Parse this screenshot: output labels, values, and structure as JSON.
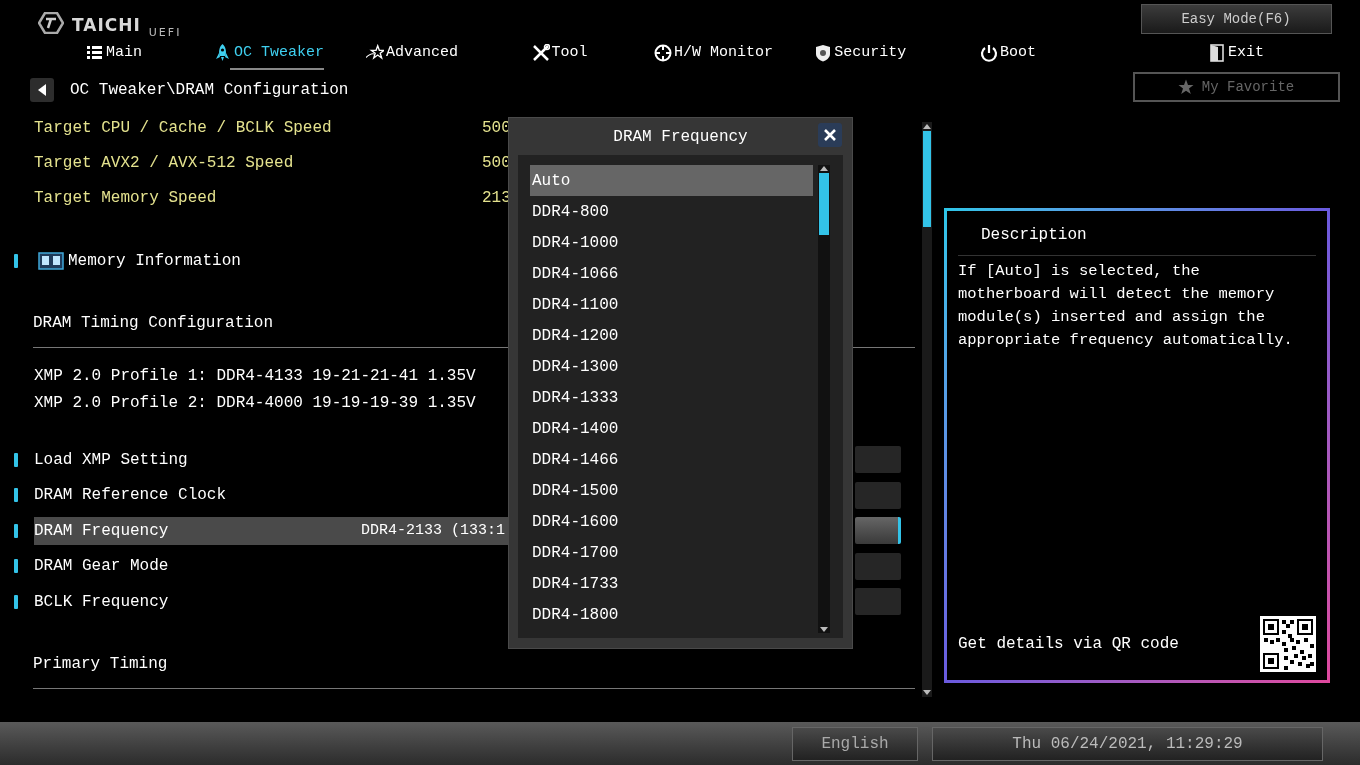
{
  "logo": {
    "brand": "TAICHI",
    "suffix": "UEFI"
  },
  "tabs": [
    {
      "label": "Main",
      "selected": false
    },
    {
      "label": "OC Tweaker",
      "selected": true
    },
    {
      "label": "Advanced",
      "selected": false
    },
    {
      "label": "Tool",
      "selected": false
    },
    {
      "label": "H/W Monitor",
      "selected": false
    },
    {
      "label": "Security",
      "selected": false
    },
    {
      "label": "Boot",
      "selected": false
    },
    {
      "label": "Exit",
      "selected": false
    }
  ],
  "easy_mode_button": "Easy Mode(F6)",
  "favorite_button": "My Favorite",
  "breadcrumb": "OC Tweaker\\DRAM Configuration",
  "settings": [
    {
      "kind": "info",
      "label": "Target CPU / Cache / BCLK Speed",
      "value": "500"
    },
    {
      "kind": "info",
      "label": "Target AVX2 / AVX-512 Speed",
      "value": "500"
    },
    {
      "kind": "info",
      "label": "Target Memory Speed",
      "value": "213"
    },
    {
      "kind": "submenu",
      "label": "Memory Information"
    },
    {
      "kind": "heading",
      "label": "DRAM Timing Configuration"
    },
    {
      "kind": "text",
      "label": "XMP 2.0 Profile 1: DDR4-4133 19-21-21-41 1.35V"
    },
    {
      "kind": "text",
      "label": "XMP 2.0 Profile 2: DDR4-4000 19-19-19-39 1.35V"
    },
    {
      "kind": "option",
      "label": "Load XMP Setting",
      "selected": false
    },
    {
      "kind": "option",
      "label": "DRAM Reference Clock",
      "selected": false
    },
    {
      "kind": "option",
      "label": "DRAM Frequency",
      "value": "DDR4-2133 (133:1",
      "selected": true
    },
    {
      "kind": "option",
      "label": "DRAM Gear Mode",
      "selected": false
    },
    {
      "kind": "option",
      "label": "BCLK Frequency",
      "selected": false
    },
    {
      "kind": "heading",
      "label": "Primary Timing"
    }
  ],
  "dialog": {
    "title": "DRAM Frequency",
    "options": [
      {
        "label": "Auto",
        "selected": true
      },
      {
        "label": "DDR4-800",
        "selected": false
      },
      {
        "label": "DDR4-1000",
        "selected": false
      },
      {
        "label": "DDR4-1066",
        "selected": false
      },
      {
        "label": "DDR4-1100",
        "selected": false
      },
      {
        "label": "DDR4-1200",
        "selected": false
      },
      {
        "label": "DDR4-1300",
        "selected": false
      },
      {
        "label": "DDR4-1333",
        "selected": false
      },
      {
        "label": "DDR4-1400",
        "selected": false
      },
      {
        "label": "DDR4-1466",
        "selected": false
      },
      {
        "label": "DDR4-1500",
        "selected": false
      },
      {
        "label": "DDR4-1600",
        "selected": false
      },
      {
        "label": "DDR4-1700",
        "selected": false
      },
      {
        "label": "DDR4-1733",
        "selected": false
      },
      {
        "label": "DDR4-1800",
        "selected": false
      }
    ]
  },
  "description": {
    "title": "Description",
    "text": "If [Auto] is selected, the motherboard will detect the memory module(s) inserted and assign the appropriate frequency automatically.",
    "qr_caption": "Get details via QR code"
  },
  "status_bar": {
    "language": "English",
    "datetime": "Thu 06/24/2021, 11:29:29"
  }
}
